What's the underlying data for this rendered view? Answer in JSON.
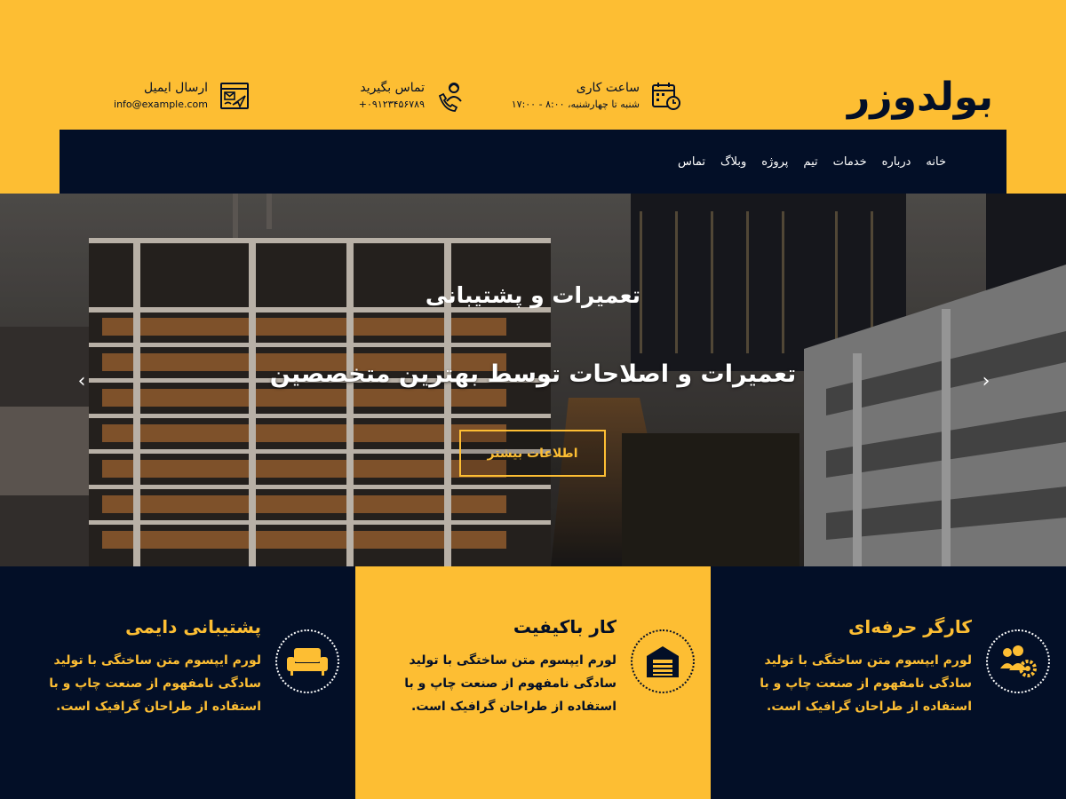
{
  "colors": {
    "accent": "#fdbe33",
    "dark": "#030f27"
  },
  "brand": {
    "logo": "بولدوزر"
  },
  "topbar": {
    "hours": {
      "title": "ساعت کاری",
      "value": "شنبه تا چهارشنبه، ۸:۰۰ - ۱۷:۰۰",
      "icon": "calendar-clock-icon"
    },
    "call": {
      "title": "تماس بگیرید",
      "value": "۰۹۱۲۳۴۵۶۷۸۹+",
      "icon": "phone-support-icon"
    },
    "email": {
      "title": "ارسال ایمیل",
      "value": "info@example.com",
      "icon": "email-send-icon"
    }
  },
  "nav": {
    "items": [
      "خانه",
      "درباره",
      "خدمات",
      "تیم",
      "پروژه",
      "وبلاگ",
      "تماس"
    ]
  },
  "hero": {
    "title": "تعمیرات و پشتیبانی",
    "subtitle": "تعمیرات و اصلاحات توسط بهترین متخصصین",
    "button": "اطلاعات بیشتر",
    "prev_icon": "chevron-left-icon",
    "next_icon": "chevron-right-icon"
  },
  "features": [
    {
      "title": "کارگر حرفه‌ای",
      "text": "لورم ایپسوم متن ساختگی با تولید سادگی نامفهوم از صنعت چاپ و با استفاده از طراحان گرافیک است.",
      "icon": "workers-gear-icon"
    },
    {
      "title": "کار باکیفیت",
      "text": "لورم ایپسوم متن ساختگی با تولید سادگی نامفهوم از صنعت چاپ و با استفاده از طراحان گرافیک است.",
      "icon": "warehouse-icon"
    },
    {
      "title": "پشتیبانی دایمی",
      "text": "لورم ایپسوم متن ساختگی با تولید سادگی نامفهوم از صنعت چاپ و با استفاده از طراحان گرافیک است.",
      "icon": "sofa-icon"
    }
  ]
}
